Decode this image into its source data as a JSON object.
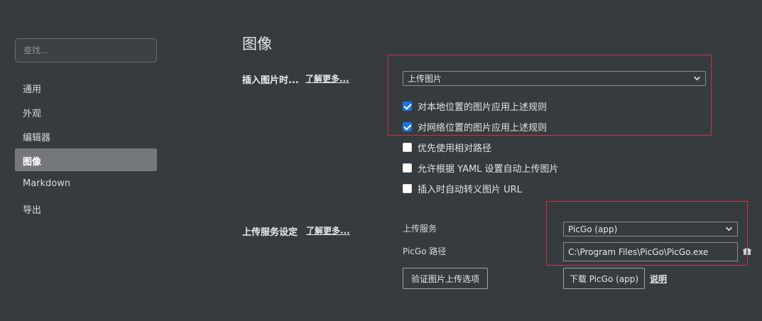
{
  "sidebar": {
    "search_placeholder": "查找...",
    "items": [
      {
        "label": "通用"
      },
      {
        "label": "外观"
      },
      {
        "label": "编辑器"
      },
      {
        "label": "图像"
      },
      {
        "label": "Markdown"
      },
      {
        "label": "导出"
      }
    ],
    "active_index": 3
  },
  "main": {
    "title": "图像",
    "insert_section": {
      "label": "插入图片时...",
      "learn_more": "了解更多...",
      "action_select": "上传图片",
      "options": [
        {
          "label": "对本地位置的图片应用上述规则",
          "checked": true
        },
        {
          "label": "对网络位置的图片应用上述规则",
          "checked": true
        },
        {
          "label": "优先使用相对路径",
          "checked": false
        },
        {
          "label": "允许根据 YAML 设置自动上传图片",
          "checked": false
        },
        {
          "label": "插入时自动转义图片 URL",
          "checked": false
        }
      ]
    },
    "upload_section": {
      "label": "上传服务设定",
      "learn_more": "了解更多...",
      "service_label": "上传服务",
      "service_value": "PicGo (app)",
      "path_label": "PicGo 路径",
      "path_value": "C:\\Program Files\\PicGo\\PicGo.exe",
      "verify_button": "验证图片上传选项",
      "download_button": "下载 PicGo (app)",
      "doc_link": "说明"
    }
  },
  "colors": {
    "background": "#363b40",
    "active_nav": "#74777c",
    "checkbox_checked": "#1a73e8",
    "highlight_box": "#d0323a"
  }
}
